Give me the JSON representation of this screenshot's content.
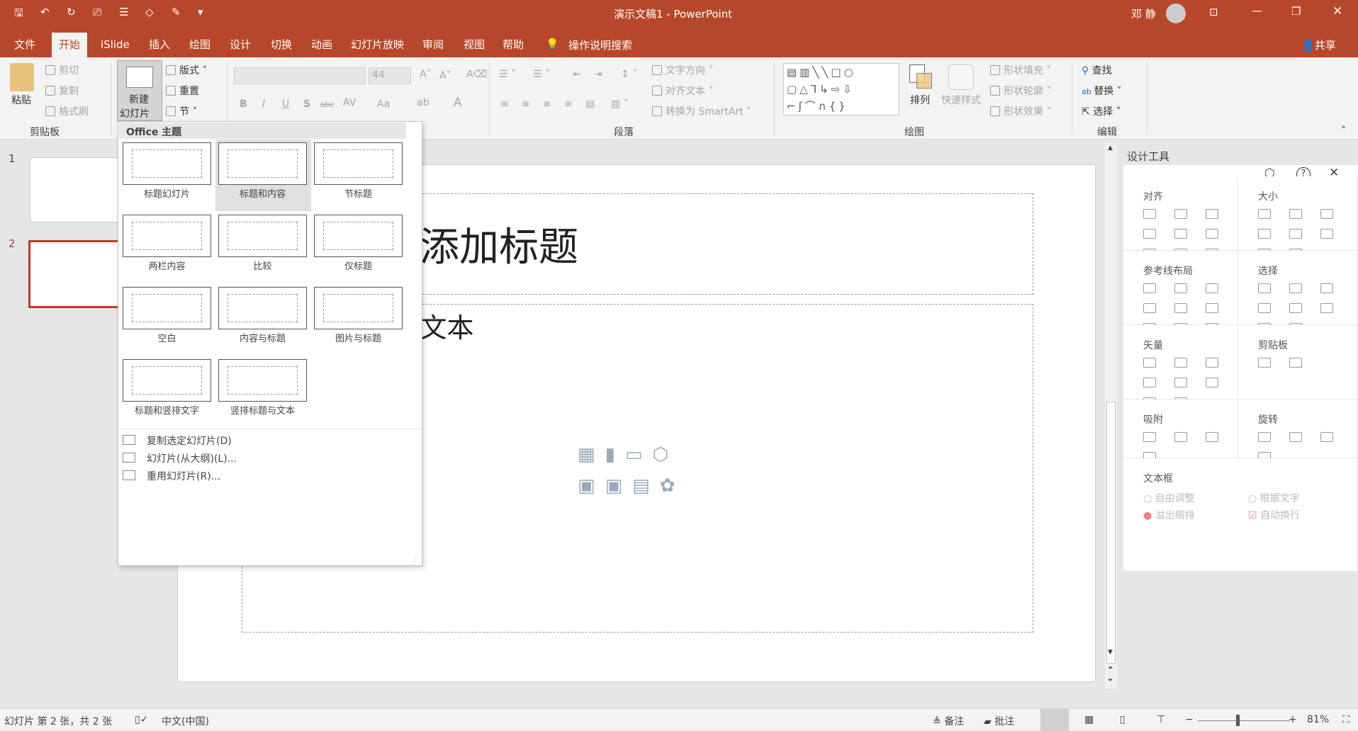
{
  "window": {
    "title": "演示文稿1  -  PowerPoint",
    "user": "邓 静",
    "share": "共享",
    "accent": "#b7472a"
  },
  "qat": [
    "save-icon",
    "undo-icon",
    "redo-icon",
    "present-icon",
    "list-icon",
    "shape-icon",
    "brush-icon",
    "customize-icon"
  ],
  "tabs": [
    "文件",
    "开始",
    "iSlide",
    "插入",
    "绘图",
    "设计",
    "切换",
    "动画",
    "幻灯片放映",
    "审阅",
    "视图",
    "帮助"
  ],
  "active_tab": "开始",
  "search": "操作说明搜索",
  "ribbon": {
    "clipboard": {
      "paste": "粘贴",
      "cut": "剪切",
      "copy": "复制",
      "format_painter": "格式刷",
      "label": "剪贴板"
    },
    "slides": {
      "new_slide_1": "新建",
      "new_slide_2": "幻灯片",
      "layout": "版式",
      "reset": "重置",
      "section": "节"
    },
    "font": {
      "name": "",
      "size": "44",
      "bold": "B",
      "italic": "I",
      "underline": "U",
      "shadow": "S",
      "strike": "abc",
      "spacing": "AV",
      "case": "Aa",
      "color": "A"
    },
    "paragraph": {
      "text_direction": "文字方向",
      "align_text": "对齐文本",
      "smartart": "转换为 SmartArt",
      "label": "段落"
    },
    "drawing": {
      "arrange": "排列",
      "quick_styles": "快速样式",
      "fill": "形状填充",
      "outline": "形状轮廓",
      "effects": "形状效果",
      "label": "绘图"
    },
    "editing": {
      "find": "查找",
      "replace": "替换",
      "select": "选择",
      "label": "编辑"
    }
  },
  "thumbnails": [
    {
      "num": "1"
    },
    {
      "num": "2",
      "selected": true
    }
  ],
  "slide": {
    "title_ph": "添加标题",
    "content_ph": "l文本"
  },
  "dropdown": {
    "header": "Office 主题",
    "layouts": [
      "标题幻灯片",
      "标题和内容",
      "节标题",
      "两栏内容",
      "比较",
      "仅标题",
      "空白",
      "内容与标题",
      "图片与标题",
      "标题和竖排文字",
      "竖排标题与文本"
    ],
    "selected_layout": "标题和内容",
    "menu": [
      "复制选定幻灯片(D)",
      "幻灯片(从大纲)(L)...",
      "重用幻灯片(R)..."
    ]
  },
  "pane": {
    "title": "设计工具",
    "sections": [
      {
        "title": "对齐",
        "icons": 9
      },
      {
        "title": "大小",
        "icons": 8
      },
      {
        "title": "参考线布局",
        "icons": 9
      },
      {
        "title": "选择",
        "icons": 8
      },
      {
        "title": "矢量",
        "icons": 8
      },
      {
        "title": "剪贴板",
        "icons": 2
      },
      {
        "title": "吸附",
        "icons": 4
      },
      {
        "title": "旋转",
        "icons": 4
      }
    ],
    "textbox": {
      "title": "文本框",
      "options": [
        "自由调整",
        "根据文字",
        "溢出缩排",
        "自动换行"
      ]
    }
  },
  "status": {
    "slide_info": "幻灯片 第 2 张，共 2 张",
    "language": "中文(中国)",
    "notes": "备注",
    "comments": "批注",
    "zoom": "81%",
    "zoom_percent": 81
  }
}
